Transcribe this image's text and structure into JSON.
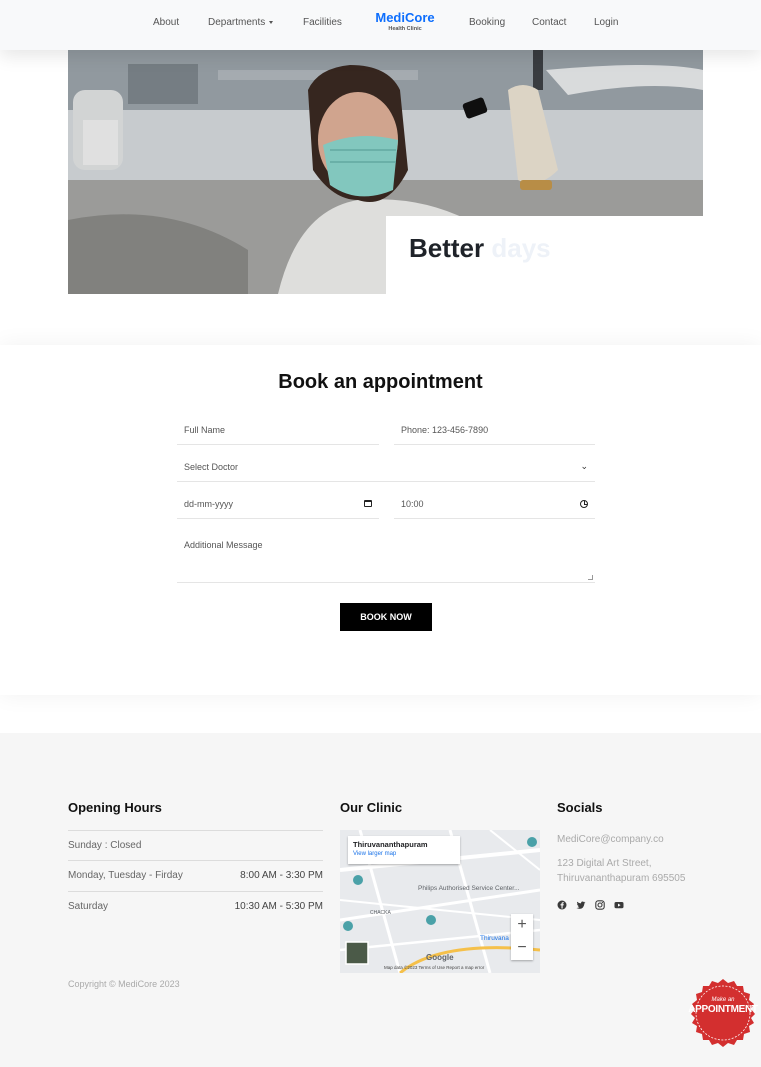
{
  "nav": {
    "links": [
      "About",
      "Departments",
      "Facilities",
      "Booking",
      "Contact",
      "Login"
    ],
    "brand_name": "MediCore",
    "brand_sub": "Health Clinic"
  },
  "hero": {
    "title_main": "Better",
    "title_faded": "days"
  },
  "booking": {
    "title": "Book an appointment",
    "full_name_placeholder": "Full Name",
    "phone_placeholder": "Phone: 123-456-7890",
    "doctor_select": "Select Doctor",
    "date_placeholder": "dd-mm-yyyy",
    "time_value": "10:00",
    "message_placeholder": "Additional Message",
    "submit_label": "BOOK NOW"
  },
  "footer": {
    "hours_title": "Opening Hours",
    "hours": [
      {
        "day": "Sunday : Closed",
        "time": ""
      },
      {
        "day": "Monday, Tuesday - Firday",
        "time": "8:00 AM - 3:30 PM"
      },
      {
        "day": "Saturday",
        "time": "10:30 AM - 5:30 PM"
      }
    ],
    "clinic_title": "Our Clinic",
    "map": {
      "place": "Thiruvananthapuram",
      "view_link": "View larger map",
      "label_philips": "Philips Authorised Service Center...",
      "label_chacka": "CHACKA",
      "label_city": "Thiruvana",
      "attribution": "Map data ©2023   Terms of Use   Report a map error",
      "zoom_in": "+",
      "zoom_out": "−"
    },
    "socials_title": "Socials",
    "email": "MediCore@company.co",
    "address_line1": "123 Digital Art Street,",
    "address_line2": "Thiruvananthapuram 695505",
    "social_icons": [
      "facebook-icon",
      "twitter-icon",
      "instagram-icon",
      "youtube-icon"
    ],
    "copyright": "Copyright © MediCore 2023"
  },
  "badge": {
    "small": "Make an",
    "big": "APPOINTMENT"
  },
  "colors": {
    "brand": "#0d6efd",
    "badge_red": "#d32f2f"
  }
}
